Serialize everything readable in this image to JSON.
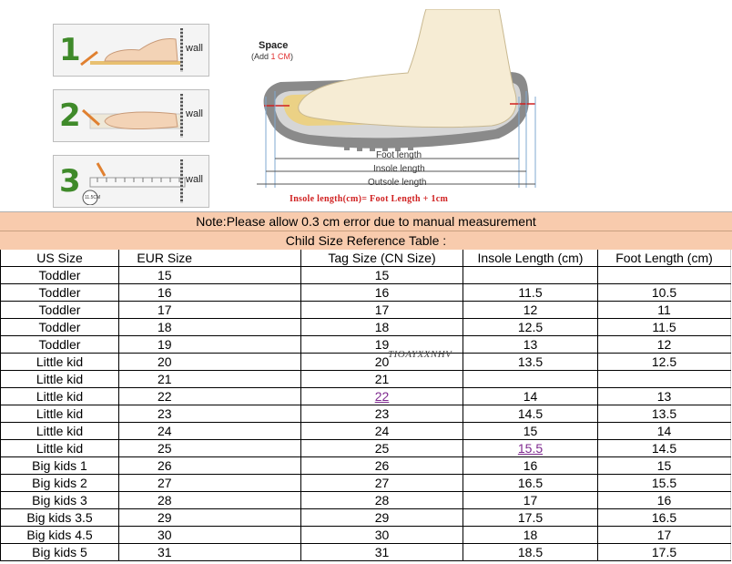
{
  "illustration": {
    "steps": [
      {
        "number": "1",
        "wall_label": "wall"
      },
      {
        "number": "2",
        "wall_label": "wall"
      },
      {
        "number": "3",
        "wall_label": "wall",
        "ruler_tag": "11.5CM"
      }
    ],
    "space_label": "Space",
    "add_prefix": "(Add ",
    "add_value": "1 CM",
    "add_suffix": ")",
    "foot_length_label": "Foot length",
    "insole_length_label": "Insole length",
    "outsole_length_label": "Outsole length",
    "formula": "Insole length(cm)= Foot Length + 1cm",
    "colors": {
      "step_green": "#3f8a2a",
      "formula_red": "#d02020",
      "insole_yellow": "#f0d070"
    }
  },
  "table": {
    "note": "Note:Please allow 0.3 cm error due to manual measurement",
    "title": "Child Size Reference Table :",
    "headers": [
      "US Size",
      "EUR Size",
      "",
      "Tag Size (CN Size)",
      "Insole Length (cm)",
      "Foot Length (cm)"
    ],
    "rows": [
      [
        "Toddler",
        "15",
        "",
        "15",
        "",
        ""
      ],
      [
        "Toddler",
        "16",
        "",
        "16",
        "11.5",
        "10.5"
      ],
      [
        "Toddler",
        "17",
        "",
        "17",
        "12",
        "11"
      ],
      [
        "Toddler",
        "18",
        "",
        "18",
        "12.5",
        "11.5"
      ],
      [
        "Toddler",
        "19",
        "",
        "19",
        "13",
        "12"
      ],
      [
        "Little kid",
        "20",
        "",
        "20",
        "13.5",
        "12.5"
      ],
      [
        "Little kid",
        "21",
        "",
        "21",
        "",
        ""
      ],
      [
        "Little kid",
        "22",
        "",
        "22",
        "14",
        "13"
      ],
      [
        "Little kid",
        "23",
        "",
        "23",
        "14.5",
        "13.5"
      ],
      [
        "Little kid",
        "24",
        "",
        "24",
        "15",
        "14"
      ],
      [
        "Little kid",
        "25",
        "",
        "25",
        "15.5",
        "14.5"
      ],
      [
        "Big kids 1",
        "26",
        "",
        "26",
        "16",
        "15"
      ],
      [
        "Big kids 2",
        "27",
        "",
        "27",
        "16.5",
        "15.5"
      ],
      [
        "Big kids 3",
        "28",
        "",
        "28",
        "17",
        "16"
      ],
      [
        "Big kids 3.5",
        "29",
        "",
        "29",
        "17.5",
        "16.5"
      ],
      [
        "Big kids 4.5",
        "30",
        "",
        "30",
        "18",
        "17"
      ],
      [
        "Big kids 5",
        "31",
        "",
        "31",
        "18.5",
        "17.5"
      ]
    ],
    "watermark": "TIOAYXXNHV",
    "colors": {
      "banner_bg": "#f8cbad",
      "link_purple": "#7f2a8f"
    }
  }
}
